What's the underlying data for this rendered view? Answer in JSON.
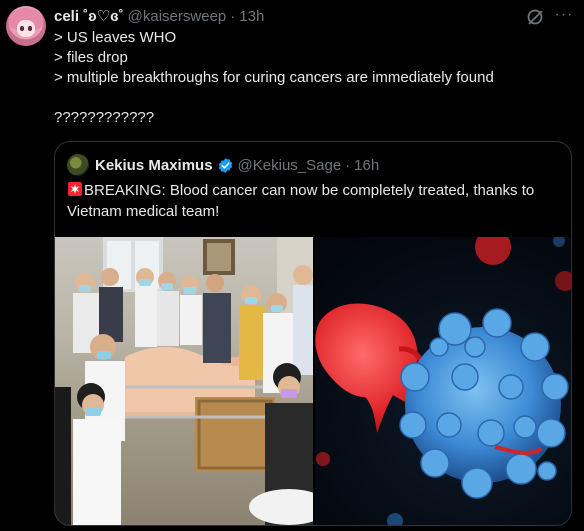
{
  "author": {
    "display_name": "celi ˚ʚ♡ɞ˚",
    "handle": "@kaisersweep",
    "separator": "·",
    "time": "13h"
  },
  "icons": {
    "grok": "grok-icon",
    "more": "more-icon",
    "more_glyph": "···"
  },
  "tweet": {
    "lines": [
      "> US leaves WHO",
      "> files drop",
      "> multiple breakthroughs for curing cancers are immediately found",
      "",
      "????????????"
    ]
  },
  "quote": {
    "display_name": "Kekius Maximus",
    "handle": "@Kekius_Sage",
    "separator": "·",
    "time": "16h",
    "text": "BREAKING: Blood cancer can now be completely treated, thanks to Vietnam medical team!",
    "emoji": "siren-icon"
  },
  "colors": {
    "background": "#000000",
    "text": "#e7e9ea",
    "secondary": "#71767b",
    "border": "#2f3336",
    "verified": "#1d9bf0"
  }
}
